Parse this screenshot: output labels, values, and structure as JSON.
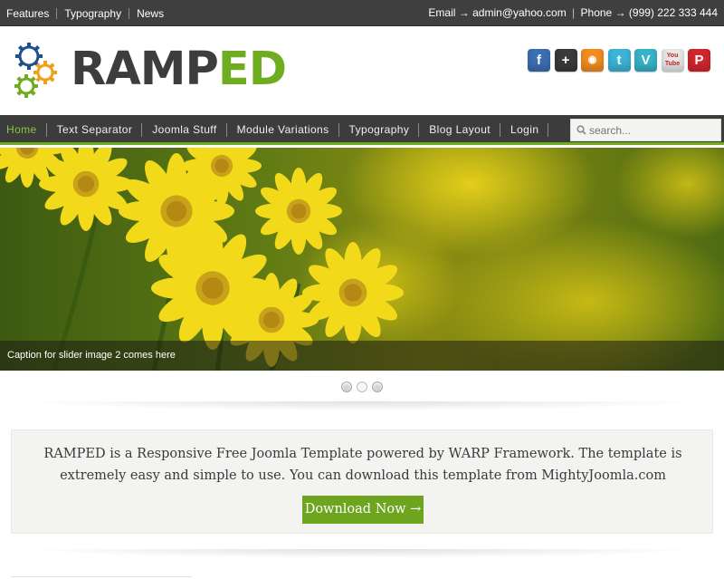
{
  "topbar": {
    "links": [
      "Features",
      "Typography",
      "News"
    ],
    "email_label": "Email",
    "arrow": "→",
    "email": "admin@yahoo.com",
    "separator": "|",
    "phone_label": "Phone",
    "phone": "(999) 222 333 444"
  },
  "logo": {
    "text_dark": "RAMP",
    "text_green": "ED",
    "colors": {
      "dark": "#3d3d3d",
      "green": "#6fac1f"
    }
  },
  "social": [
    {
      "name": "facebook-icon",
      "glyph": "f",
      "color": "#3b6fb3"
    },
    {
      "name": "google-plus-icon",
      "glyph": "+",
      "color": "#3a3a3a"
    },
    {
      "name": "rss-icon",
      "glyph": "◉",
      "color": "#f28c1f"
    },
    {
      "name": "twitter-icon",
      "glyph": "t",
      "color": "#3cb4d8"
    },
    {
      "name": "vimeo-icon",
      "glyph": "V",
      "color": "#35b3c9"
    },
    {
      "name": "youtube-icon",
      "glyph": "You Tube",
      "color": "#e8e8e8"
    },
    {
      "name": "pinterest-icon",
      "glyph": "P",
      "color": "#d2262d"
    }
  ],
  "nav": {
    "items": [
      "Home",
      "Text Separator",
      "Joomla Stuff",
      "Module Variations",
      "Typography",
      "Blog Layout",
      "Login"
    ],
    "active_index": 0,
    "accent": "#6fac1f",
    "search_placeholder": "search..."
  },
  "slider": {
    "caption": "Caption for slider image 2 comes here",
    "slide_count": 3,
    "active_index": 1
  },
  "intro": {
    "text": "RAMPED is a Responsive Free Joomla Template powered by WARP Framework. The template is extremely easy and simple to use. You can download this template from MightyJoomla.com",
    "button": "Download Now →",
    "button_color": "#6ea51e"
  }
}
